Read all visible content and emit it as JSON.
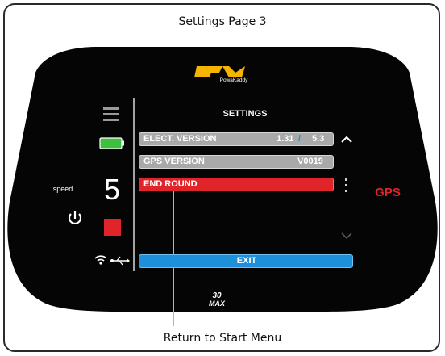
{
  "caption_top": "Settings Page 3",
  "caption_bottom": "Return to Start Menu",
  "logo": {
    "brand": "PowaKaddy",
    "model": "30v MAX"
  },
  "left_panel": {
    "speed_label": "speed",
    "speed_value": "5"
  },
  "screen": {
    "title": "SETTINGS",
    "rows": [
      {
        "label": "ELECT. VERSION",
        "value_a": "1.31",
        "separator": "/",
        "value_b": "5.3"
      },
      {
        "label": "GPS VERSION",
        "value": "V0019"
      },
      {
        "label": "END ROUND"
      }
    ],
    "exit_label": "EXIT",
    "gps_label": "GPS"
  },
  "colors": {
    "accent_red": "#e0242a",
    "exit_blue": "#1e8fd8",
    "battery_green": "#3fbf3f",
    "callout_line": "#f2b21a",
    "logo_yellow": "#f5b400"
  }
}
